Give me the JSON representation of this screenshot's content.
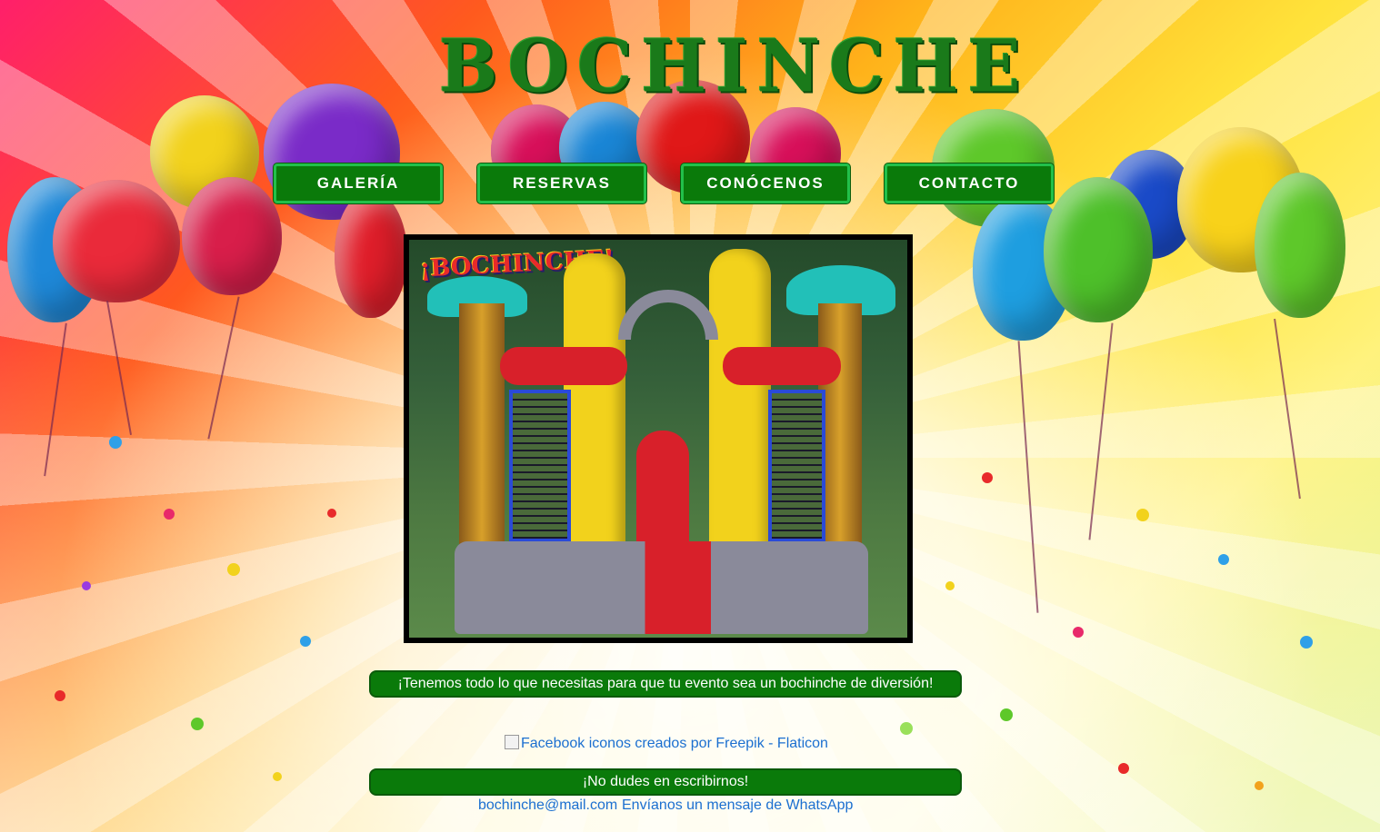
{
  "site": {
    "logo_text": "BOCHINCHE"
  },
  "nav": [
    {
      "label": "GALERÍA"
    },
    {
      "label": "RESERVAS"
    },
    {
      "label": "CONÓCENOS"
    },
    {
      "label": "CONTACTO"
    }
  ],
  "hero": {
    "sign_text": "¡BOCHINCHE!"
  },
  "tagline": "¡Tenemos todo lo que necesitas para que tu evento sea un bochinche de diversión!",
  "social": {
    "facebook_alt": "Facebook iconos creados por Freepik - Flaticon"
  },
  "cta": "¡No dudes en escribirnos!",
  "contact": {
    "email": "bochinche@mail.com",
    "whatsapp": "Envíanos un mensaje de WhatsApp"
  },
  "colors": {
    "brand_green": "#0a7a0a",
    "button_border": "#22c04a",
    "link_blue": "#1b6fd0"
  }
}
